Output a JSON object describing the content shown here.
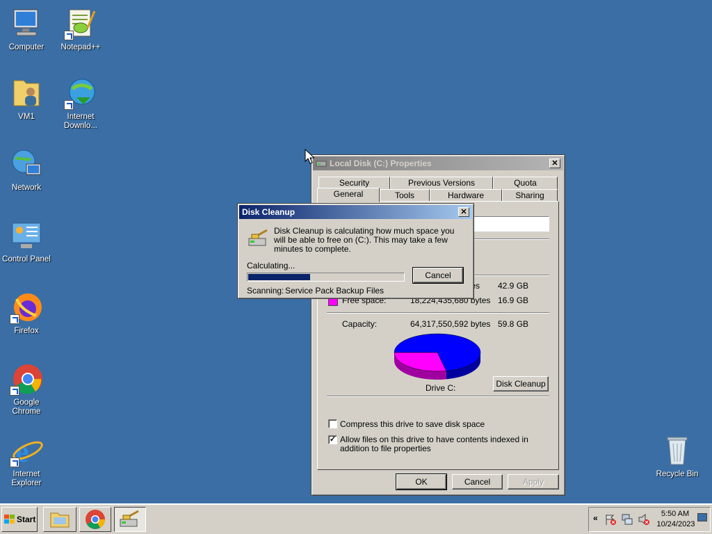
{
  "desktop": {
    "icons": [
      {
        "label": "Computer"
      },
      {
        "label": "Notepad++"
      },
      {
        "label": "VM1"
      },
      {
        "label": "Internet Downlo..."
      },
      {
        "label": "Network"
      },
      {
        "label": "Control Panel"
      },
      {
        "label": "Firefox"
      },
      {
        "label": "Google Chrome"
      },
      {
        "label": "Internet Explorer"
      },
      {
        "label": "Recycle Bin"
      }
    ]
  },
  "properties": {
    "title": "Local Disk (C:) Properties",
    "tabs_top": [
      "Security",
      "Previous Versions",
      "Quota"
    ],
    "tabs_bottom": [
      "General",
      "Tools",
      "Hardware",
      "Sharing"
    ],
    "used_bytes_partial": "ytes",
    "used_size": "42.9 GB",
    "free_label": "Free space:",
    "free_bytes": "18,224,435,680 bytes",
    "free_size": "16.9 GB",
    "capacity_label": "Capacity:",
    "capacity_bytes": "64,317,550,592 bytes",
    "capacity_size": "59.8 GB",
    "drive_label": "Drive C:",
    "disk_cleanup_button": "Disk Cleanup",
    "compress_label": "Compress this drive to save disk space",
    "index_label": "Allow files on this drive to have contents indexed in addition to file properties",
    "compress_checked": false,
    "index_checked": true,
    "ok_button": "OK",
    "cancel_button": "Cancel",
    "apply_button": "Apply",
    "used_fraction": 0.717,
    "colors": {
      "used": "#0000ff",
      "free": "#ff00ff"
    }
  },
  "cleanup": {
    "title": "Disk Cleanup",
    "message": "Disk Cleanup is calculating how much space you will be able to free on  (C:). This may take a few minutes to complete.",
    "calculating": "Calculating...",
    "cancel_button": "Cancel",
    "scanning_label": "Scanning:",
    "scanning_item": "Service Pack Backup Files",
    "progress": 0.4
  },
  "taskbar": {
    "start_label": "Start",
    "time": "5:50 AM",
    "date": "10/24/2023"
  }
}
